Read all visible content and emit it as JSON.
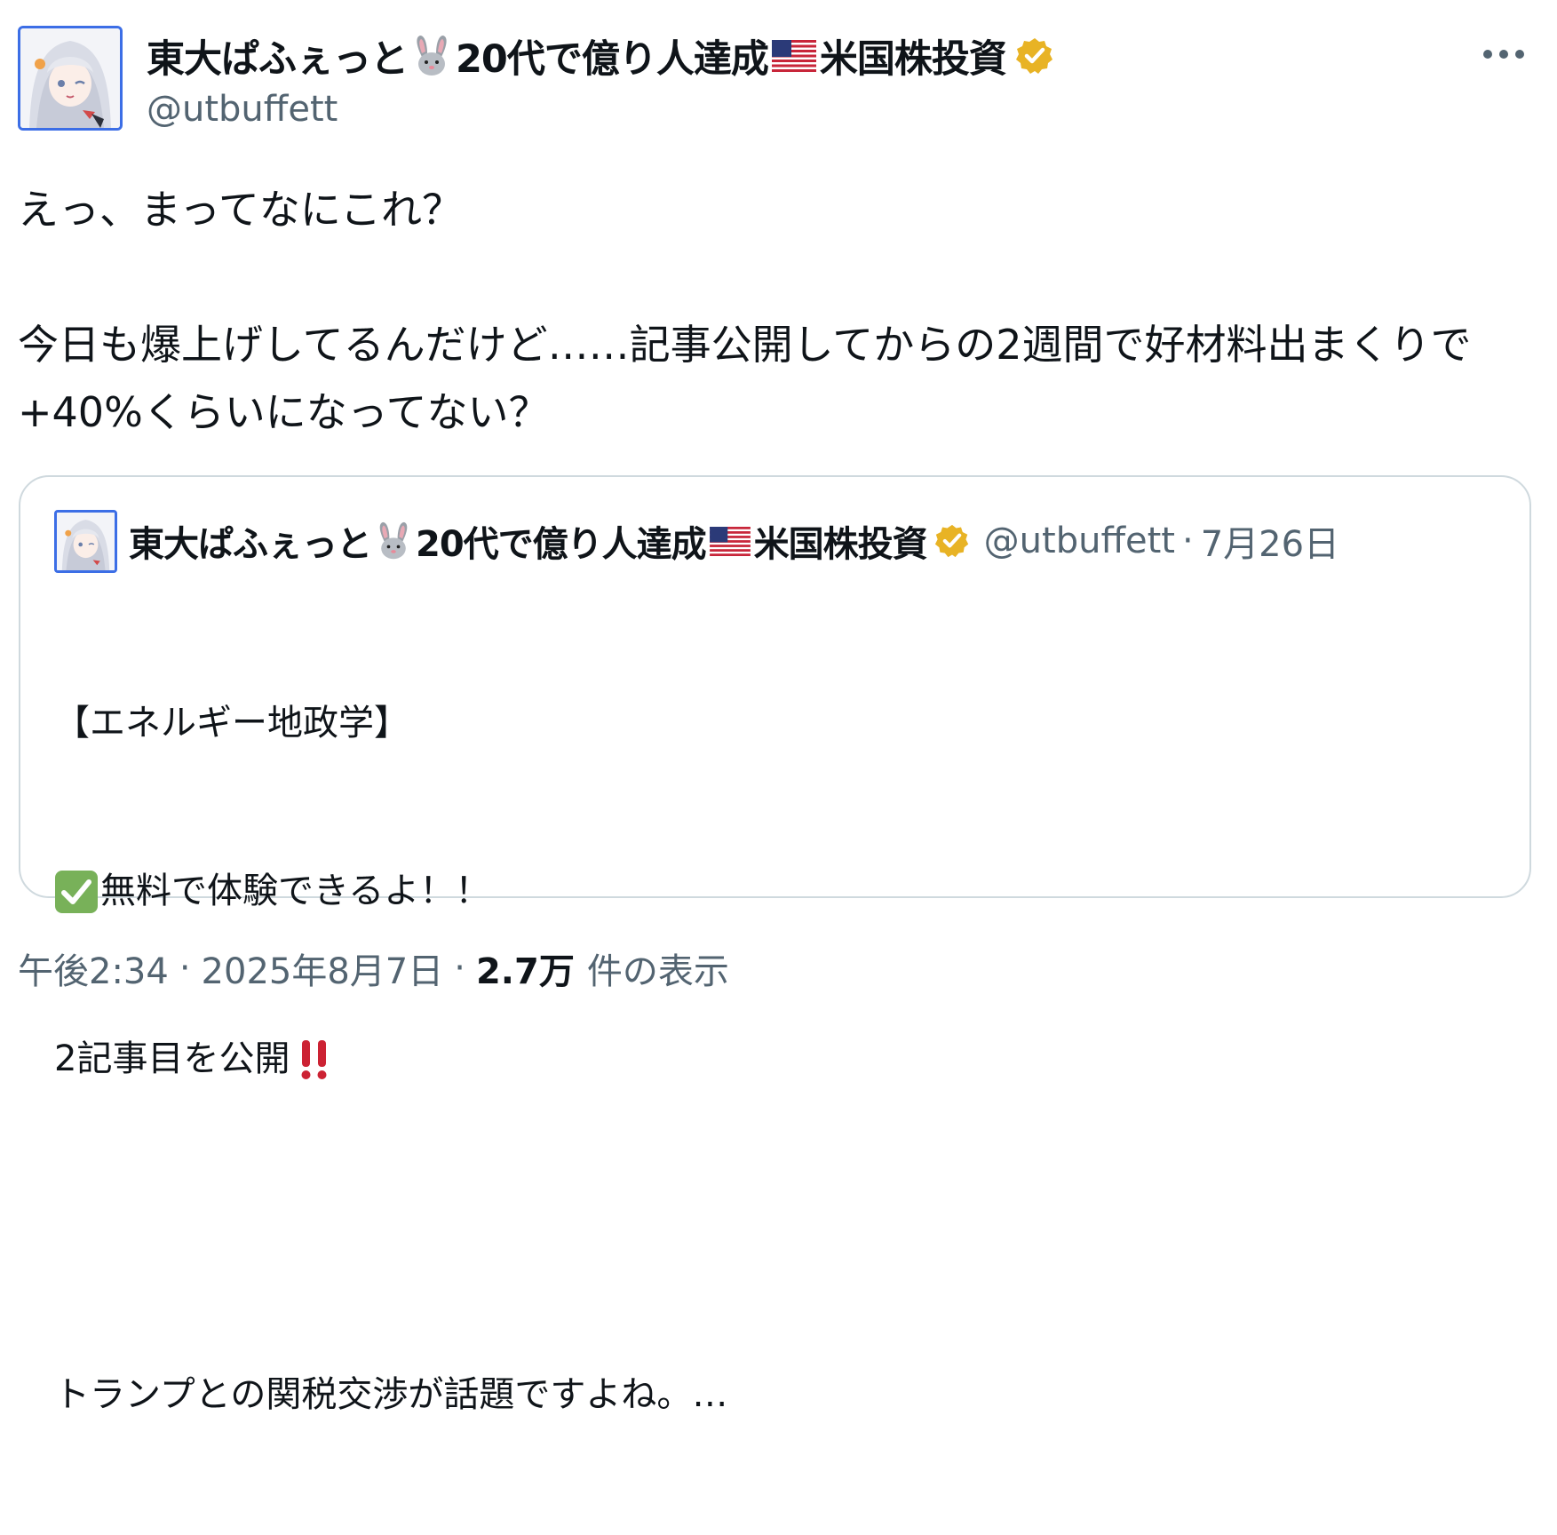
{
  "author": {
    "name_parts": [
      "東大ぱふぇっと",
      "20代で億り人達成",
      "米国株投資"
    ],
    "handle": "@utbuffett",
    "verified_color": "#e8b325"
  },
  "more_icon": "more-horizontal-icon",
  "tweet": {
    "text": "えっ、まってなにこれ？\n\n今日も爆上げしてるんだけど……記事公開してからの2週間で好材料出まくりで+40%くらいになってない？"
  },
  "quoted": {
    "name_parts": [
      "東大ぱふぇっと",
      "20代で億り人達成",
      "米国株投資"
    ],
    "handle": "@utbuffett",
    "dot": "·",
    "date": "7月26日",
    "lines": {
      "l1": "【エネルギー地政学】",
      "l2": "無料で体験できるよ！！",
      "l3": "2記事目を公開",
      "l5": "トランプとの関税交渉が話題ですよね。…"
    }
  },
  "meta": {
    "time": "午後2:34",
    "sep": "·",
    "date": "2025年8月7日",
    "views_count": "2.7万",
    "views_label": "件の表示"
  }
}
